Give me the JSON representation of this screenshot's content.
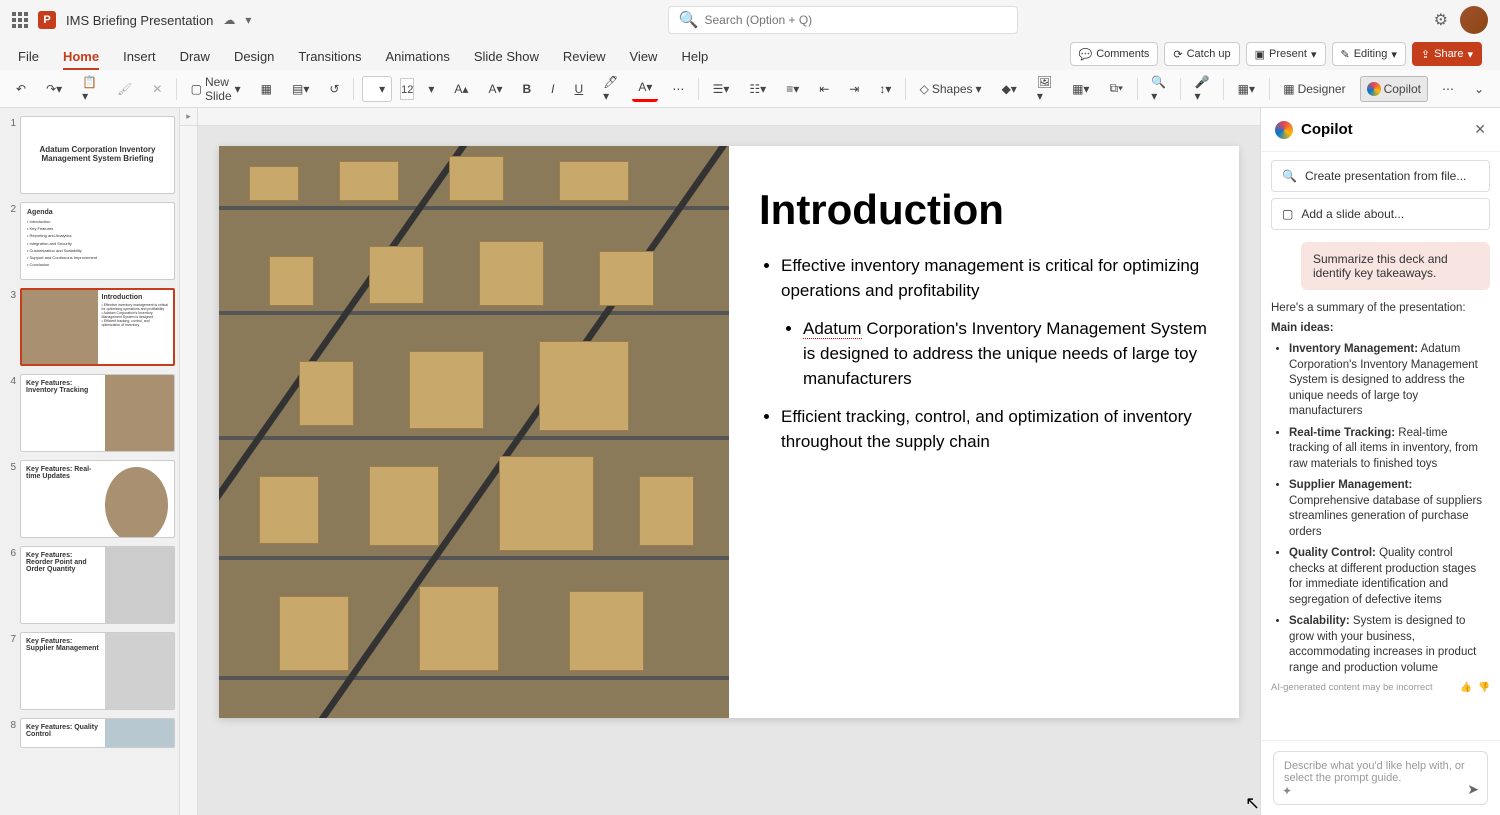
{
  "title": "IMS Briefing Presentation",
  "search_placeholder": "Search (Option + Q)",
  "menu": [
    "File",
    "Home",
    "Insert",
    "Draw",
    "Design",
    "Transitions",
    "Animations",
    "Slide Show",
    "Review",
    "View",
    "Help"
  ],
  "menu_right": {
    "comments": "Comments",
    "catchup": "Catch up",
    "present": "Present",
    "editing": "Editing",
    "share": "Share"
  },
  "ribbon": {
    "new_slide": "New Slide",
    "font_size": "12",
    "shapes": "Shapes",
    "designer": "Designer",
    "copilot": "Copilot"
  },
  "thumbnails": [
    {
      "n": "1",
      "title": "Adatum Corporation Inventory Management System Briefing"
    },
    {
      "n": "2",
      "title": "Agenda"
    },
    {
      "n": "3",
      "title": "Introduction",
      "active": true
    },
    {
      "n": "4",
      "title": "Key Features: Inventory Tracking"
    },
    {
      "n": "5",
      "title": "Key Features: Real-time Updates"
    },
    {
      "n": "6",
      "title": "Key Features: Reorder Point and Order Quantity"
    },
    {
      "n": "7",
      "title": "Key Features: Supplier Management"
    },
    {
      "n": "8",
      "title": "Key Features: Quality Control"
    }
  ],
  "slide": {
    "heading": "Introduction",
    "bullets": [
      "Effective inventory management is critical for optimizing operations and profitability",
      "Adatum Corporation's Inventory Management System is designed to address the unique needs of large toy manufacturers",
      "Efficient tracking, control, and optimization of inventory throughout the supply chain"
    ]
  },
  "copilot": {
    "title": "Copilot",
    "suggest1": "Create presentation from file...",
    "suggest2": "Add a slide about...",
    "user_msg": "Summarize this deck and identify key takeaways.",
    "intro": "Here's a summary of the presentation:",
    "main_ideas_label": "Main ideas:",
    "items": [
      {
        "b": "Inventory Management:",
        "t": " Adatum Corporation's Inventory Management System is designed to address the unique needs of large toy manufacturers"
      },
      {
        "b": "Real-time Tracking:",
        "t": " Real-time tracking of all items in inventory, from raw materials to finished toys"
      },
      {
        "b": "Supplier Management:",
        "t": " Comprehensive database of suppliers streamlines generation of purchase orders"
      },
      {
        "b": "Quality Control:",
        "t": " Quality control checks at different production stages for immediate identification and segregation of defective items"
      },
      {
        "b": "Scalability:",
        "t": " System is designed to grow with your business, accommodating increases in product range and production volume"
      }
    ],
    "disclaimer": "AI-generated content may be incorrect",
    "input_placeholder": "Describe what you'd like help with, or select the prompt guide."
  }
}
